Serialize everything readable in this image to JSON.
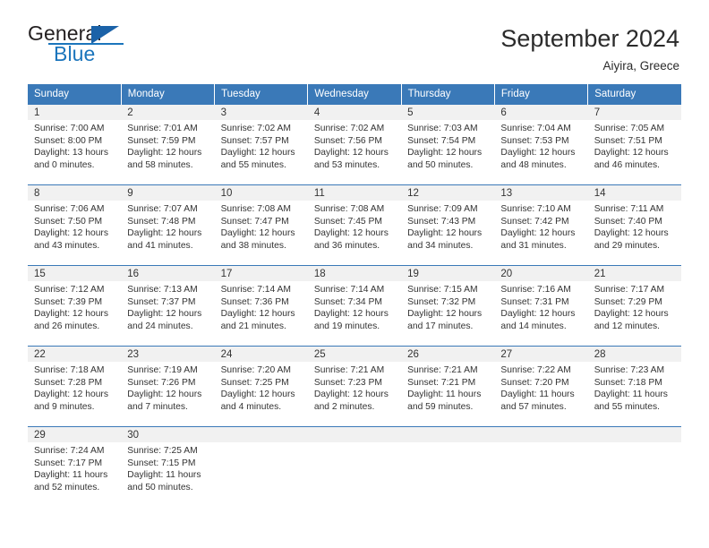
{
  "logo": {
    "word_top": "General",
    "word_bottom": "Blue",
    "triangle_icon": "blue-triangle-icon",
    "accent_color": "#1b75bc"
  },
  "header": {
    "title": "September 2024",
    "location": "Aiyira, Greece"
  },
  "colors": {
    "header_blue": "#3a79b8",
    "daynum_gray": "#f1f1f1",
    "text": "#333333"
  },
  "weekdays": [
    "Sunday",
    "Monday",
    "Tuesday",
    "Wednesday",
    "Thursday",
    "Friday",
    "Saturday"
  ],
  "labels": {
    "sunrise": "Sunrise:",
    "sunset": "Sunset:",
    "daylight": "Daylight:"
  },
  "weeks": [
    [
      {
        "day": "1",
        "sunrise": "Sunrise: 7:00 AM",
        "sunset": "Sunset: 8:00 PM",
        "daylight1": "Daylight: 13 hours",
        "daylight2": "and 0 minutes."
      },
      {
        "day": "2",
        "sunrise": "Sunrise: 7:01 AM",
        "sunset": "Sunset: 7:59 PM",
        "daylight1": "Daylight: 12 hours",
        "daylight2": "and 58 minutes."
      },
      {
        "day": "3",
        "sunrise": "Sunrise: 7:02 AM",
        "sunset": "Sunset: 7:57 PM",
        "daylight1": "Daylight: 12 hours",
        "daylight2": "and 55 minutes."
      },
      {
        "day": "4",
        "sunrise": "Sunrise: 7:02 AM",
        "sunset": "Sunset: 7:56 PM",
        "daylight1": "Daylight: 12 hours",
        "daylight2": "and 53 minutes."
      },
      {
        "day": "5",
        "sunrise": "Sunrise: 7:03 AM",
        "sunset": "Sunset: 7:54 PM",
        "daylight1": "Daylight: 12 hours",
        "daylight2": "and 50 minutes."
      },
      {
        "day": "6",
        "sunrise": "Sunrise: 7:04 AM",
        "sunset": "Sunset: 7:53 PM",
        "daylight1": "Daylight: 12 hours",
        "daylight2": "and 48 minutes."
      },
      {
        "day": "7",
        "sunrise": "Sunrise: 7:05 AM",
        "sunset": "Sunset: 7:51 PM",
        "daylight1": "Daylight: 12 hours",
        "daylight2": "and 46 minutes."
      }
    ],
    [
      {
        "day": "8",
        "sunrise": "Sunrise: 7:06 AM",
        "sunset": "Sunset: 7:50 PM",
        "daylight1": "Daylight: 12 hours",
        "daylight2": "and 43 minutes."
      },
      {
        "day": "9",
        "sunrise": "Sunrise: 7:07 AM",
        "sunset": "Sunset: 7:48 PM",
        "daylight1": "Daylight: 12 hours",
        "daylight2": "and 41 minutes."
      },
      {
        "day": "10",
        "sunrise": "Sunrise: 7:08 AM",
        "sunset": "Sunset: 7:47 PM",
        "daylight1": "Daylight: 12 hours",
        "daylight2": "and 38 minutes."
      },
      {
        "day": "11",
        "sunrise": "Sunrise: 7:08 AM",
        "sunset": "Sunset: 7:45 PM",
        "daylight1": "Daylight: 12 hours",
        "daylight2": "and 36 minutes."
      },
      {
        "day": "12",
        "sunrise": "Sunrise: 7:09 AM",
        "sunset": "Sunset: 7:43 PM",
        "daylight1": "Daylight: 12 hours",
        "daylight2": "and 34 minutes."
      },
      {
        "day": "13",
        "sunrise": "Sunrise: 7:10 AM",
        "sunset": "Sunset: 7:42 PM",
        "daylight1": "Daylight: 12 hours",
        "daylight2": "and 31 minutes."
      },
      {
        "day": "14",
        "sunrise": "Sunrise: 7:11 AM",
        "sunset": "Sunset: 7:40 PM",
        "daylight1": "Daylight: 12 hours",
        "daylight2": "and 29 minutes."
      }
    ],
    [
      {
        "day": "15",
        "sunrise": "Sunrise: 7:12 AM",
        "sunset": "Sunset: 7:39 PM",
        "daylight1": "Daylight: 12 hours",
        "daylight2": "and 26 minutes."
      },
      {
        "day": "16",
        "sunrise": "Sunrise: 7:13 AM",
        "sunset": "Sunset: 7:37 PM",
        "daylight1": "Daylight: 12 hours",
        "daylight2": "and 24 minutes."
      },
      {
        "day": "17",
        "sunrise": "Sunrise: 7:14 AM",
        "sunset": "Sunset: 7:36 PM",
        "daylight1": "Daylight: 12 hours",
        "daylight2": "and 21 minutes."
      },
      {
        "day": "18",
        "sunrise": "Sunrise: 7:14 AM",
        "sunset": "Sunset: 7:34 PM",
        "daylight1": "Daylight: 12 hours",
        "daylight2": "and 19 minutes."
      },
      {
        "day": "19",
        "sunrise": "Sunrise: 7:15 AM",
        "sunset": "Sunset: 7:32 PM",
        "daylight1": "Daylight: 12 hours",
        "daylight2": "and 17 minutes."
      },
      {
        "day": "20",
        "sunrise": "Sunrise: 7:16 AM",
        "sunset": "Sunset: 7:31 PM",
        "daylight1": "Daylight: 12 hours",
        "daylight2": "and 14 minutes."
      },
      {
        "day": "21",
        "sunrise": "Sunrise: 7:17 AM",
        "sunset": "Sunset: 7:29 PM",
        "daylight1": "Daylight: 12 hours",
        "daylight2": "and 12 minutes."
      }
    ],
    [
      {
        "day": "22",
        "sunrise": "Sunrise: 7:18 AM",
        "sunset": "Sunset: 7:28 PM",
        "daylight1": "Daylight: 12 hours",
        "daylight2": "and 9 minutes."
      },
      {
        "day": "23",
        "sunrise": "Sunrise: 7:19 AM",
        "sunset": "Sunset: 7:26 PM",
        "daylight1": "Daylight: 12 hours",
        "daylight2": "and 7 minutes."
      },
      {
        "day": "24",
        "sunrise": "Sunrise: 7:20 AM",
        "sunset": "Sunset: 7:25 PM",
        "daylight1": "Daylight: 12 hours",
        "daylight2": "and 4 minutes."
      },
      {
        "day": "25",
        "sunrise": "Sunrise: 7:21 AM",
        "sunset": "Sunset: 7:23 PM",
        "daylight1": "Daylight: 12 hours",
        "daylight2": "and 2 minutes."
      },
      {
        "day": "26",
        "sunrise": "Sunrise: 7:21 AM",
        "sunset": "Sunset: 7:21 PM",
        "daylight1": "Daylight: 11 hours",
        "daylight2": "and 59 minutes."
      },
      {
        "day": "27",
        "sunrise": "Sunrise: 7:22 AM",
        "sunset": "Sunset: 7:20 PM",
        "daylight1": "Daylight: 11 hours",
        "daylight2": "and 57 minutes."
      },
      {
        "day": "28",
        "sunrise": "Sunrise: 7:23 AM",
        "sunset": "Sunset: 7:18 PM",
        "daylight1": "Daylight: 11 hours",
        "daylight2": "and 55 minutes."
      }
    ],
    [
      {
        "day": "29",
        "sunrise": "Sunrise: 7:24 AM",
        "sunset": "Sunset: 7:17 PM",
        "daylight1": "Daylight: 11 hours",
        "daylight2": "and 52 minutes."
      },
      {
        "day": "30",
        "sunrise": "Sunrise: 7:25 AM",
        "sunset": "Sunset: 7:15 PM",
        "daylight1": "Daylight: 11 hours",
        "daylight2": "and 50 minutes."
      },
      {
        "day": "",
        "sunrise": "",
        "sunset": "",
        "daylight1": "",
        "daylight2": ""
      },
      {
        "day": "",
        "sunrise": "",
        "sunset": "",
        "daylight1": "",
        "daylight2": ""
      },
      {
        "day": "",
        "sunrise": "",
        "sunset": "",
        "daylight1": "",
        "daylight2": ""
      },
      {
        "day": "",
        "sunrise": "",
        "sunset": "",
        "daylight1": "",
        "daylight2": ""
      },
      {
        "day": "",
        "sunrise": "",
        "sunset": "",
        "daylight1": "",
        "daylight2": ""
      }
    ]
  ]
}
